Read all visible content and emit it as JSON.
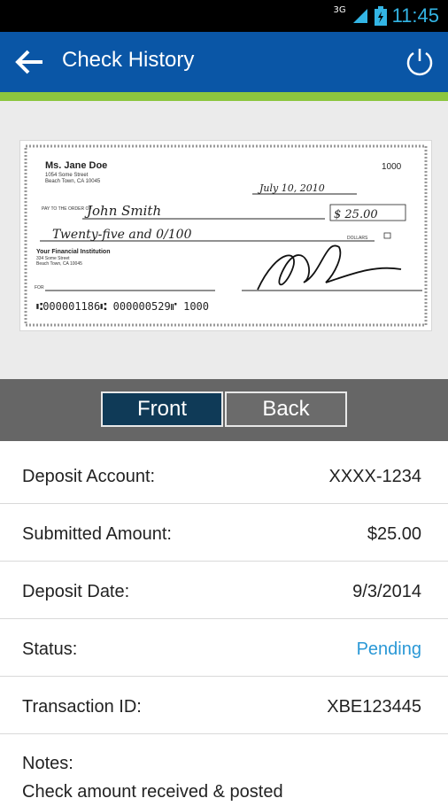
{
  "statusbar": {
    "network": "3G",
    "time": "11:45"
  },
  "appbar": {
    "title": "Check History"
  },
  "check": {
    "payer_name": "Ms. Jane Doe",
    "payer_address1": "1054 Some Street",
    "payer_address2": "Beach Town, CA 10045",
    "check_number": "1000",
    "date": "July 10, 2010",
    "pay_to_label": "PAY TO THE ORDER OF",
    "payee": "John Smith",
    "amount_numeric": "$ 25.00",
    "amount_words": "Twenty-five and 0/100",
    "dollars_label": "DOLLARS",
    "bank_name": "Your Financial Institution",
    "bank_address1": "334 Some Street",
    "bank_address2": "Beach Town, CA 10045",
    "for_label": "FOR",
    "micr": "⑆000001186⑆  000000529⑈  1000"
  },
  "toggle": {
    "front_label": "Front",
    "back_label": "Back"
  },
  "details": [
    {
      "label": "Deposit Account:",
      "value": "XXXX-1234"
    },
    {
      "label": "Submitted Amount:",
      "value": "$25.00"
    },
    {
      "label": "Deposit Date:",
      "value": "9/3/2014"
    },
    {
      "label": "Status:",
      "value": "Pending"
    },
    {
      "label": "Transaction ID:",
      "value": "XBE123445"
    }
  ],
  "notes": {
    "label": "Notes:",
    "text": "Check amount received & posted"
  },
  "colors": {
    "appbar": "#0a56a6",
    "accent_green": "#8cc63e",
    "pending": "#2a98d6",
    "front_selected": "#0f3a57"
  }
}
